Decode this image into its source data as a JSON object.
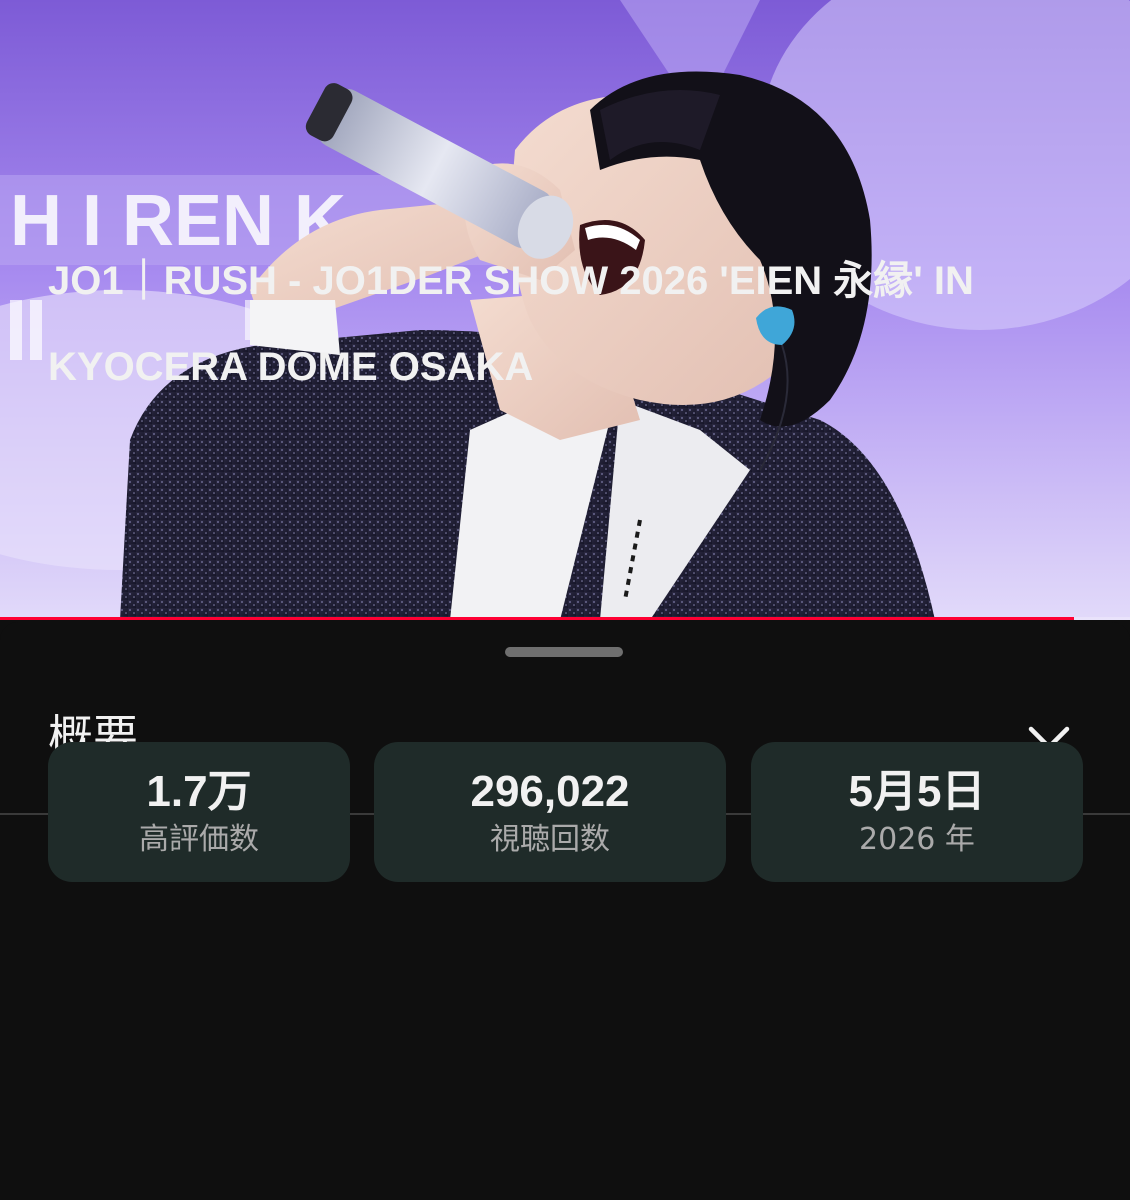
{
  "player": {
    "progress_fraction": 0.95,
    "progress_color": "#ff0033",
    "stage_text": "H  I REN  K"
  },
  "description_sheet": {
    "title": "概要",
    "close_icon": "close-icon",
    "video_title": "JO1｜RUSH - JO1DER SHOW 2026 'EIEN 永縁' IN KYOCERA DOME OSAKA",
    "stats": [
      {
        "value": "1.7万",
        "label": "高評価数"
      },
      {
        "value": "296,022",
        "label": "視聴回数"
      },
      {
        "value": "5月5日",
        "label": "2026 年"
      }
    ]
  },
  "colors": {
    "background": "#0f0f0f",
    "card": "#1f2b29",
    "text_primary": "#f1f1f1",
    "text_secondary": "#aaaaaa"
  }
}
